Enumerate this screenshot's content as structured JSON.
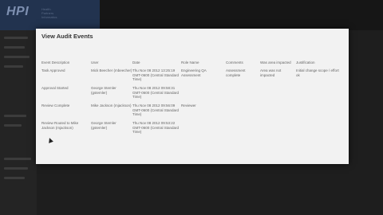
{
  "background": {
    "logo": "HPI",
    "logo_sub": [
      "Health",
      "Partners",
      "Informatics"
    ]
  },
  "modal": {
    "title": "View Audit Events",
    "columns": [
      "Event Description",
      "User",
      "Date",
      "Role Name",
      "Comments",
      "Was area impacted",
      "Justification"
    ],
    "rows": [
      {
        "event": "Task Approved",
        "user": "Mick Beecher (mbeecher)",
        "date": "Thu Nov 08 2012 13:25:19 GMT-0600 (Central Standard Time)",
        "role": "Engineering QA Assessment",
        "comments": "Assessment complete",
        "impacted": "Area was not impacted",
        "justification": "Initial change scope / effort ok"
      },
      {
        "event": "Approval Started",
        "user": "George Stemler (gstemler)",
        "date": "Thu Nov 08 2012 09:58:31 GMT-0600 (Central Standard Time)",
        "role": "",
        "comments": "",
        "impacted": "",
        "justification": ""
      },
      {
        "event": "Review Complete",
        "user": "Mike Jackson (mjackson)",
        "date": "Thu Nov 08 2012 09:56:09 GMT-0600 (Central Standard Time)",
        "role": "Reviewer",
        "comments": "",
        "impacted": "",
        "justification": ""
      },
      {
        "event": "Review Routed to Mike Jackson (mjackson)",
        "user": "George Stemler (gstemler)",
        "date": "Thu Nov 08 2012 09:53:22 GMT-0600 (Central Standard Time)",
        "role": "",
        "comments": "",
        "impacted": "",
        "justification": ""
      }
    ]
  }
}
